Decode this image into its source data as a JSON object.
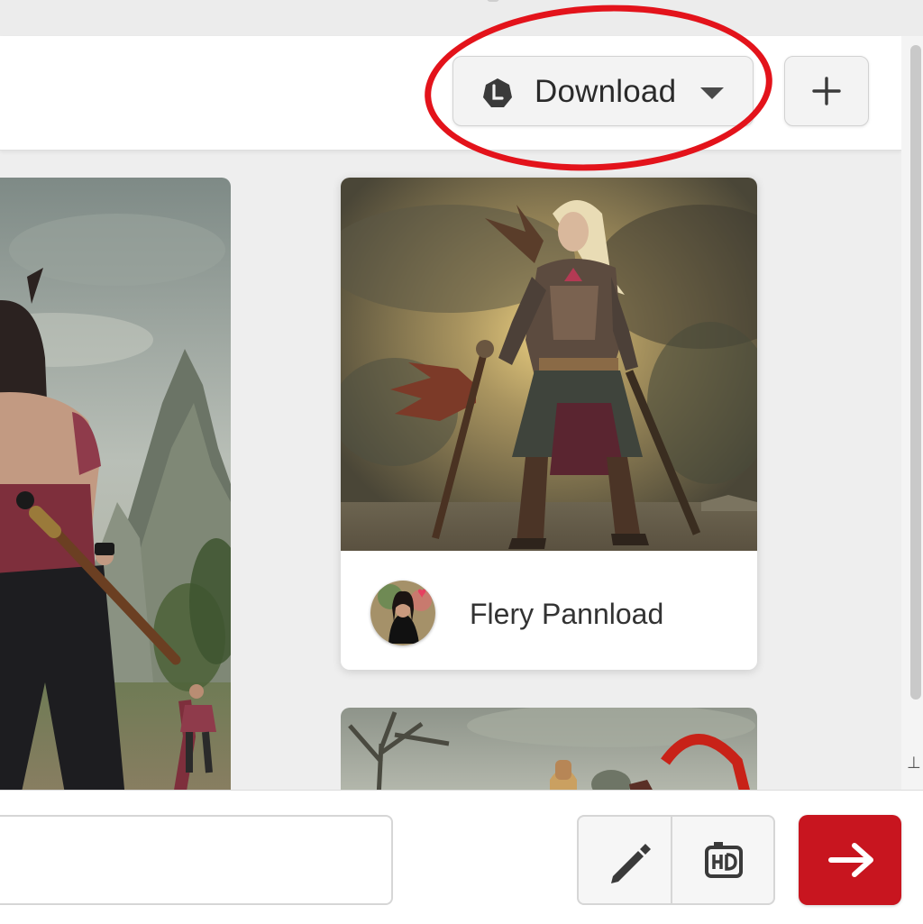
{
  "header": {
    "download_button": {
      "label": "Download",
      "icon": "download-badge-icon",
      "caret_icon": "caret-down-icon"
    },
    "add_button": {
      "icon": "plus-icon"
    }
  },
  "feed": {
    "cards": [
      {
        "kind": "image-partial",
        "subject": "warrior-with-staff"
      },
      {
        "kind": "post",
        "title": "Flery Pannload",
        "avatar_icon": "avatar",
        "badge_icon": "heart-icon"
      },
      {
        "kind": "image-partial",
        "subject": "landscape"
      }
    ]
  },
  "composer": {
    "input_value": "",
    "tools": [
      {
        "icon": "pencil-icon"
      },
      {
        "icon": "hd-icon"
      }
    ],
    "send_icon": "arrow-right-icon"
  },
  "colors": {
    "annotation_red": "#e3131b",
    "send_red": "#c8151f",
    "header_bg": "#ffffff",
    "page_bg": "#eeeeee"
  }
}
